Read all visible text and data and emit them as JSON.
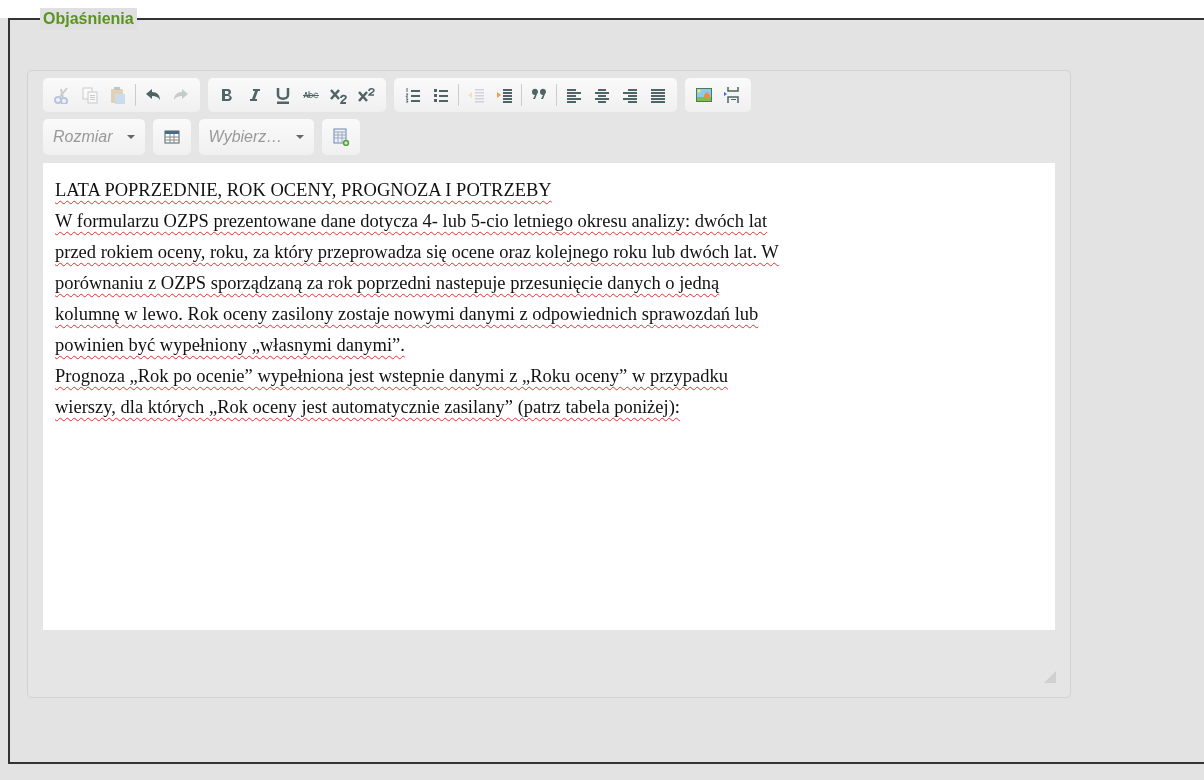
{
  "legend": "Objaśnienia",
  "toolbar_row_1": [
    {
      "sections": [
        [
          {
            "kind": "cut",
            "disabled": true
          },
          {
            "kind": "copy",
            "disabled": true
          },
          {
            "kind": "paste",
            "disabled": true
          }
        ],
        [
          {
            "kind": "undo",
            "disabled": false
          },
          {
            "kind": "redo",
            "disabled": true
          }
        ]
      ]
    },
    {
      "sections": [
        [
          {
            "kind": "bold",
            "disabled": false
          },
          {
            "kind": "italic",
            "disabled": false
          },
          {
            "kind": "underline",
            "disabled": false
          },
          {
            "kind": "strike",
            "disabled": false
          },
          {
            "kind": "subscript",
            "disabled": false
          },
          {
            "kind": "superscript",
            "disabled": false
          }
        ]
      ]
    },
    {
      "sections": [
        [
          {
            "kind": "numbered",
            "disabled": false
          },
          {
            "kind": "bulleted",
            "disabled": false
          }
        ],
        [
          {
            "kind": "outdent",
            "disabled": true
          },
          {
            "kind": "indent",
            "disabled": false
          }
        ],
        [
          {
            "kind": "quote",
            "disabled": false
          }
        ],
        [
          {
            "kind": "align-left",
            "disabled": false
          },
          {
            "kind": "align-center",
            "disabled": false
          },
          {
            "kind": "align-right",
            "disabled": false
          },
          {
            "kind": "justify",
            "disabled": false
          }
        ]
      ]
    },
    {
      "sections": [
        [
          {
            "kind": "image",
            "disabled": false
          },
          {
            "kind": "pagebreak",
            "disabled": false
          }
        ]
      ]
    }
  ],
  "toolbar_row_2": [
    {
      "kind": "dropdown",
      "placeholder": "Rozmiar"
    },
    {
      "kind": "table"
    },
    {
      "kind": "dropdown",
      "placeholder": "Wybierz…"
    },
    {
      "kind": "table-add"
    }
  ],
  "content_lines": [
    "LATA POPRZEDNIE, ROK OCENY, PROGNOZA I POTRZEBY",
    "W formularzu OZPS prezentowane dane dotycza 4- lub 5-cio letniego okresu analizy: dwóch lat",
    "przed rokiem oceny, roku, za który przeprowadza się ocene oraz kolejnego roku lub dwóch lat. W",
    "porównaniu z OZPS sporządzaną za rok poprzedni nastepuje przesunięcie danych o jedną",
    "kolumnę w lewo. Rok oceny zasilony zostaje nowymi danymi z odpowiednich sprawozdań lub",
    "powinien być wypełniony „własnymi danymi”.",
    "Prognoza „Rok po ocenie” wypełniona jest wstepnie danymi z „Roku oceny” w przypadku",
    "wierszy, dla których „Rok oceny jest automatycznie zasilany” (patrz tabela poniżej):"
  ]
}
